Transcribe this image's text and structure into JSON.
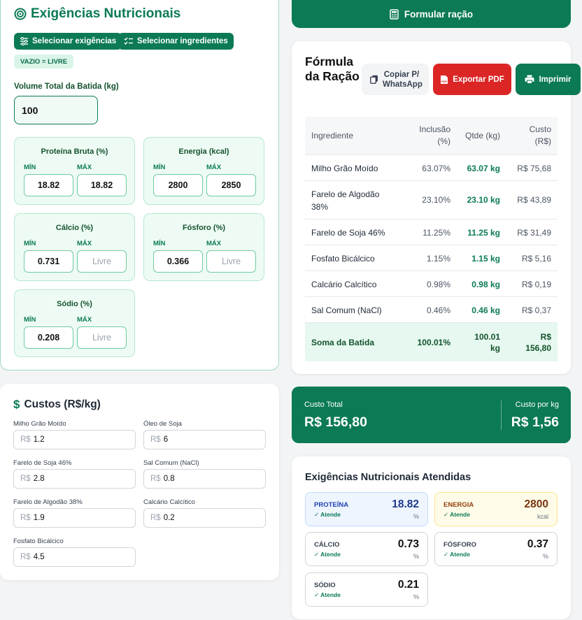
{
  "requirements": {
    "title": "Exigências Nutricionais",
    "select_requirements_label": "Selecionar exigências",
    "select_ingredients_label": "Selecionar ingredientes",
    "empty_hint": "VAZIO = LIVRE",
    "volume_label": "Volume Total da Batida (kg)",
    "volume_value": "100",
    "min_label": "MÍN",
    "max_label": "MÁX",
    "nutrients": [
      {
        "name": "Proteína Bruta (%)",
        "min": "18.82",
        "max": "18.82"
      },
      {
        "name": "Energia (kcal)",
        "min": "2800",
        "max": "2850"
      },
      {
        "name": "Cálcio (%)",
        "min": "0.731",
        "max": "Livre"
      },
      {
        "name": "Fósforo (%)",
        "min": "0.366",
        "max": "Livre"
      },
      {
        "name": "Sódio (%)",
        "min": "0.208",
        "max": "Livre"
      }
    ]
  },
  "costs": {
    "title": "Custos (R$/kg)",
    "currency_prefix": "R$",
    "items": [
      {
        "label": "Milho Grão Moído",
        "value": "1.2"
      },
      {
        "label": "Óleo de Soja",
        "value": "6"
      },
      {
        "label": "Farelo de Soja 46%",
        "value": "2.8"
      },
      {
        "label": "Sal Comum (NaCl)",
        "value": "0.8"
      },
      {
        "label": "Farelo de Algodão 38%",
        "value": "1.9"
      },
      {
        "label": "Calcário Calcítico",
        "value": "0.2"
      },
      {
        "label": "Fosfato Bicálcico",
        "value": "4.5"
      }
    ]
  },
  "formulate_button": "Formular ração",
  "formula": {
    "title": "Fórmula da Ração",
    "copy_label": "Copiar P/ WhatsApp",
    "pdf_label": "Exportar PDF",
    "print_label": "Imprimir",
    "headers": [
      "Ingrediente",
      "Inclusão (%)",
      "Qtde (kg)",
      "Custo (R$)"
    ],
    "rows": [
      {
        "name": "Milho Grão Moído",
        "inclusion": "63.07%",
        "qty": "63.07 kg",
        "cost": "R$ 75,68"
      },
      {
        "name": "Farelo de Algodão 38%",
        "inclusion": "23.10%",
        "qty": "23.10 kg",
        "cost": "R$ 43,89"
      },
      {
        "name": "Farelo de Soja 46%",
        "inclusion": "11.25%",
        "qty": "11.25 kg",
        "cost": "R$ 31,49"
      },
      {
        "name": "Fosfato Bicálcico",
        "inclusion": "1.15%",
        "qty": "1.15 kg",
        "cost": "R$ 5,16"
      },
      {
        "name": "Calcário Calcítico",
        "inclusion": "0.98%",
        "qty": "0.98 kg",
        "cost": "R$ 0,19"
      },
      {
        "name": "Sal Comum (NaCl)",
        "inclusion": "0.46%",
        "qty": "0.46 kg",
        "cost": "R$ 0,37"
      }
    ],
    "total": {
      "name": "Soma da Batida",
      "inclusion": "100.01%",
      "qty": "100.01 kg",
      "cost": "R$ 156,80"
    }
  },
  "summary": {
    "total_label": "Custo Total",
    "total_value": "R$ 156,80",
    "per_kg_label": "Custo por kg",
    "per_kg_value": "R$ 1,56"
  },
  "met": {
    "title": "Exigências Nutricionais Atendidas",
    "status": "Atende",
    "items": [
      {
        "name": "PROTEÍNA",
        "value": "18.82",
        "unit": "%"
      },
      {
        "name": "ENERGIA",
        "value": "2800",
        "unit": "kcal"
      },
      {
        "name": "CÁLCIO",
        "value": "0.73",
        "unit": "%"
      },
      {
        "name": "FÓSFORO",
        "value": "0.37",
        "unit": "%"
      },
      {
        "name": "SÓDIO",
        "value": "0.21",
        "unit": "%"
      }
    ]
  },
  "colors": {
    "primary": "#0b7a55",
    "danger": "#dc2626",
    "protein_bg": "#eef5fe",
    "energy_bg": "#fefbe8"
  }
}
